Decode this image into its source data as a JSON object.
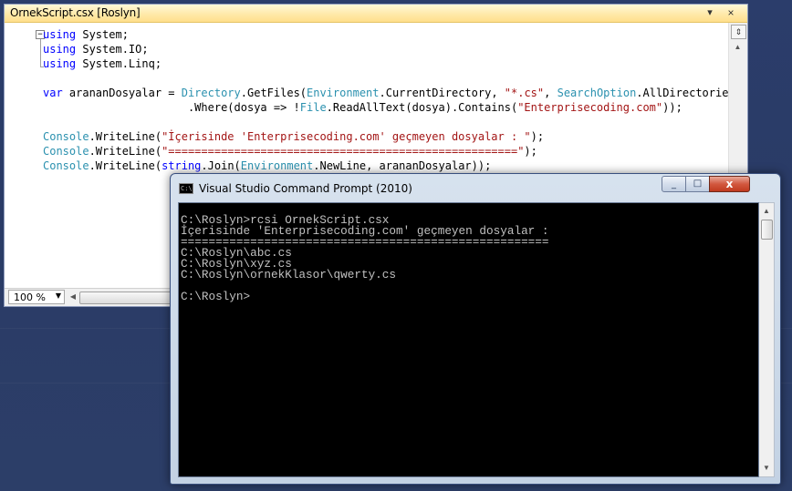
{
  "editor": {
    "title": "OrnekScript.csx [Roslyn]",
    "zoom": "100 %",
    "code_lines": [
      [
        {
          "t": "using",
          "c": "kw"
        },
        {
          "t": " System;"
        }
      ],
      [
        {
          "t": "using",
          "c": "kw"
        },
        {
          "t": " System.IO;"
        }
      ],
      [
        {
          "t": "using",
          "c": "kw"
        },
        {
          "t": " System.Linq;"
        }
      ],
      [],
      [
        {
          "t": "var",
          "c": "kw"
        },
        {
          "t": " arananDosyalar = "
        },
        {
          "t": "Directory",
          "c": "ty"
        },
        {
          "t": ".GetFiles("
        },
        {
          "t": "Environment",
          "c": "ty"
        },
        {
          "t": ".CurrentDirectory, "
        },
        {
          "t": "\"*.cs\"",
          "c": "st"
        },
        {
          "t": ", "
        },
        {
          "t": "SearchOption",
          "c": "ty"
        },
        {
          "t": ".AllDirectories)"
        }
      ],
      [
        {
          "t": "                      .Where(dosya => !"
        },
        {
          "t": "File",
          "c": "ty"
        },
        {
          "t": ".ReadAllText(dosya).Contains("
        },
        {
          "t": "\"Enterprisecoding.com\"",
          "c": "st"
        },
        {
          "t": "));"
        }
      ],
      [],
      [
        {
          "t": "Console",
          "c": "ty"
        },
        {
          "t": ".WriteLine("
        },
        {
          "t": "\"İçerisinde 'Enterprisecoding.com' geçmeyen dosyalar : \"",
          "c": "st"
        },
        {
          "t": ");"
        }
      ],
      [
        {
          "t": "Console",
          "c": "ty"
        },
        {
          "t": ".WriteLine("
        },
        {
          "t": "\"=====================================================\"",
          "c": "st"
        },
        {
          "t": ");"
        }
      ],
      [
        {
          "t": "Console",
          "c": "ty"
        },
        {
          "t": ".WriteLine("
        },
        {
          "t": "string",
          "c": "kw"
        },
        {
          "t": ".Join("
        },
        {
          "t": "Environment",
          "c": "ty"
        },
        {
          "t": ".NewLine, arananDosyalar));"
        }
      ]
    ]
  },
  "cmd": {
    "title": "Visual Studio Command Prompt (2010)",
    "lines": [
      "C:\\Roslyn>rcsi OrnekScript.csx",
      "İçerisinde 'Enterprisecoding.com' geçmeyen dosyalar :",
      "=====================================================",
      "C:\\Roslyn\\abc.cs",
      "C:\\Roslyn\\xyz.cs",
      "C:\\Roslyn\\ornekKlasor\\qwerty.cs",
      "",
      "C:\\Roslyn>"
    ]
  },
  "icons": {
    "editor_dropdown": "▾",
    "editor_close": "×",
    "split": "⇕",
    "collapse": "−",
    "scroll_up": "▲",
    "scroll_down": "▼",
    "scroll_left": "◀",
    "zoom_arrow": "▼",
    "cmd_minimize": "_",
    "cmd_maximize": "□",
    "cmd_close": "x",
    "cmd_app": "C:\\"
  }
}
